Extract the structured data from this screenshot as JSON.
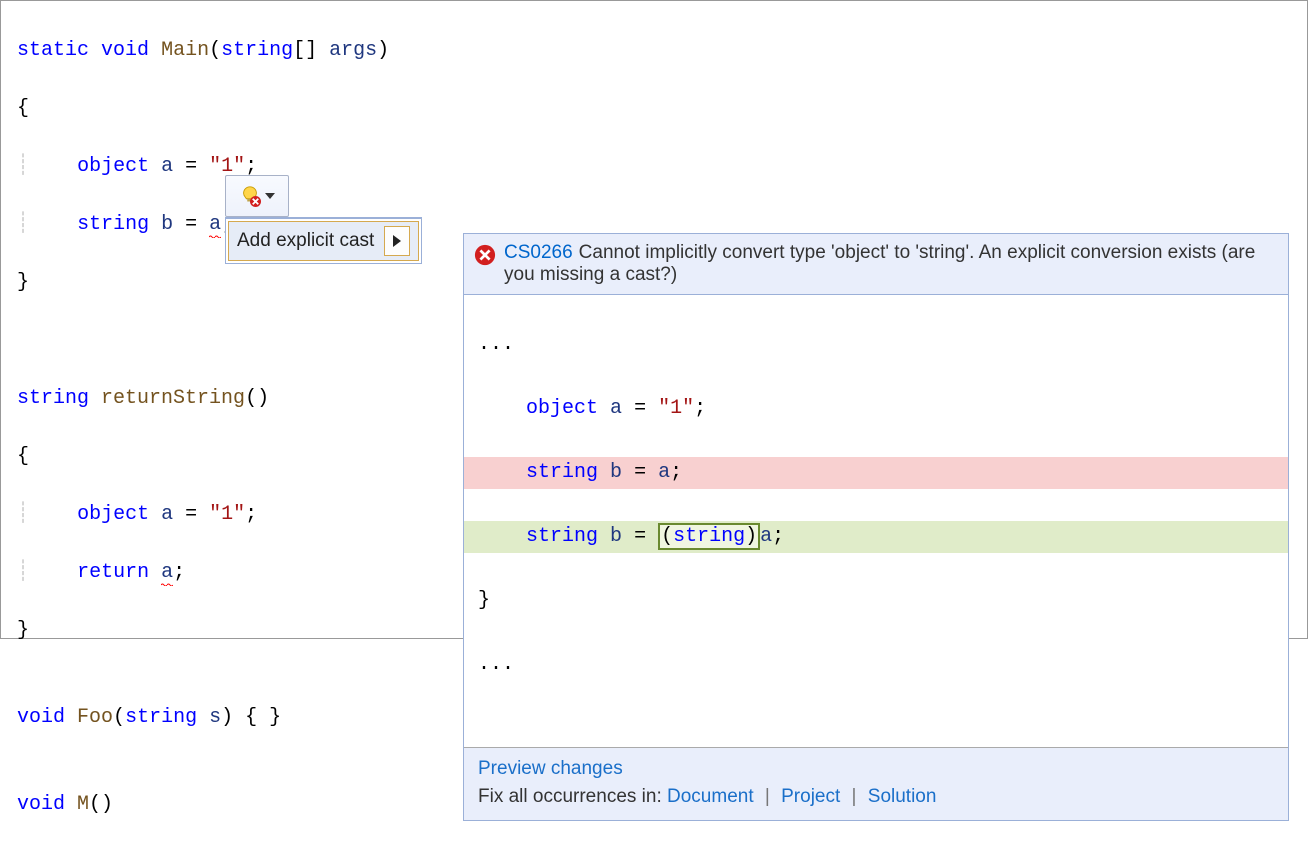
{
  "code": {
    "l1_static": "static",
    "l1_void": "void",
    "l1_main": "Main",
    "l1_paren_open": "(",
    "l1_string": "string",
    "l1_brackets": "[] ",
    "l1_args": "args",
    "l1_paren_close": ")",
    "l2_brace": "{",
    "l3_indent": "    ",
    "l3_object": "object",
    "l3_sp": " ",
    "l3_a": "a",
    "l3_eq": " = ",
    "l3_str": "\"1\"",
    "l3_semi": ";",
    "l4_indent": "    ",
    "l4_string": "string",
    "l4_sp": " ",
    "l4_b": "b",
    "l4_eq": " = ",
    "l4_a": "a",
    "l4_semi": ";",
    "l5_brace": "}",
    "blank": "",
    "l7_string": "string",
    "l7_sp": " ",
    "l7_method": "returnString",
    "l7_parens": "()",
    "l8_brace": "{",
    "l9_indent": "    ",
    "l9_object": "object",
    "l9_sp": " ",
    "l9_a": "a",
    "l9_eq": " = ",
    "l9_str": "\"1\"",
    "l9_semi": ";",
    "l10_indent": "    ",
    "l10_return": "return",
    "l10_sp": " ",
    "l10_a": "a",
    "l10_semi": ";",
    "l11_brace": "}",
    "l13_void": "void",
    "l13_sp": " ",
    "l13_foo": "Foo",
    "l13_po": "(",
    "l13_string": "string",
    "l13_sp2": " ",
    "l13_s": "s",
    "l13_pc": ") { }",
    "l15_void": "void",
    "l15_sp": " ",
    "l15_m": "M",
    "l15_parens": "()"
  },
  "action_menu": {
    "item_label": "Add explicit cast"
  },
  "preview": {
    "error_code": "CS0266",
    "error_msg": "Cannot implicitly convert type 'object' to 'string'. An explicit conversion exists (are you missing a cast?)",
    "ell_top": "...",
    "p_obj_indent": "    ",
    "p_obj_kw": "object",
    "p_obj_sp": " ",
    "p_obj_a": "a",
    "p_obj_eq": " = ",
    "p_obj_str": "\"1\"",
    "p_obj_semi": ";",
    "del_indent": "    ",
    "del_string": "string",
    "del_sp": " ",
    "del_b": "b",
    "del_eq": " = ",
    "del_a": "a",
    "del_semi": ";",
    "add_indent": "    ",
    "add_string": "string",
    "add_sp": " ",
    "add_b": "b",
    "add_eq": " = ",
    "add_cast_po": "(",
    "add_cast_type": "string",
    "add_cast_pc": ")",
    "add_a": "a",
    "add_semi": ";",
    "brace": "}",
    "ell_bot": "...",
    "preview_changes": "Preview changes",
    "fix_label": "Fix all occurrences in: ",
    "fix_doc": "Document",
    "fix_proj": "Project",
    "fix_sol": "Solution",
    "sep": " | "
  }
}
